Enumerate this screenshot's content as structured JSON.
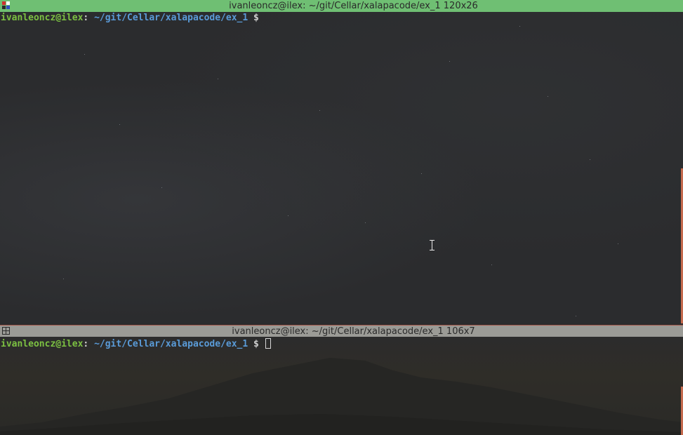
{
  "top_terminal": {
    "title": "ivanleoncz@ilex: ~/git/Cellar/xalapacode/ex_1 120x26",
    "prompt_user": "ivanleoncz@ilex",
    "prompt_sep": ":",
    "prompt_path": "~/git/Cellar/xalapacode/ex_1",
    "prompt_symbol": "$",
    "focused": false
  },
  "bottom_terminal": {
    "title": "ivanleoncz@ilex: ~/git/Cellar/xalapacode/ex_1 106x7",
    "prompt_user": "ivanleoncz@ilex",
    "prompt_sep": ":",
    "prompt_path": "~/git/Cellar/xalapacode/ex_1",
    "prompt_symbol": "$",
    "focused": true
  },
  "icons": {
    "top_window_icon": "window-menu-icon",
    "bottom_window_icon": "window-menu-icon",
    "mouse_cursor": "text-ibeam-cursor-icon"
  },
  "colors": {
    "active_titlebar": "#6fbf73",
    "inactive_titlebar": "#9b9b96",
    "prompt_user": "#7cc142",
    "prompt_path": "#5a9bd8",
    "scrollbar": "#c56a4e",
    "terminal_bg": "#2b2c2e"
  }
}
